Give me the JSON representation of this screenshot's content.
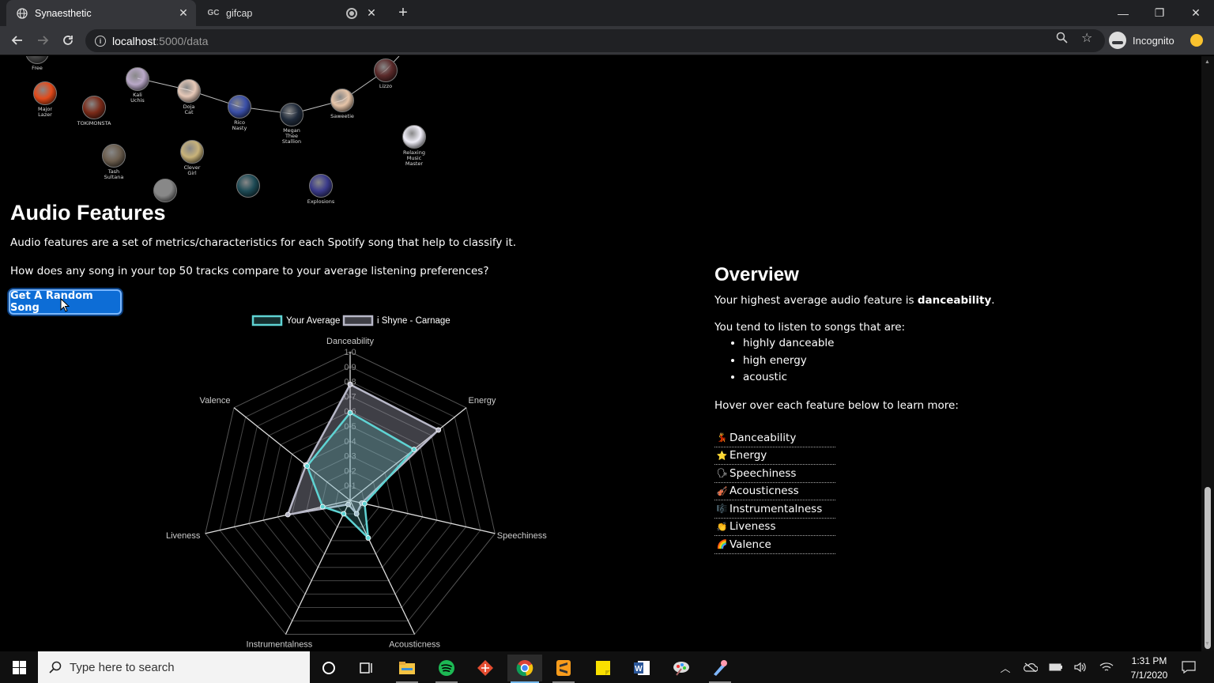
{
  "browser": {
    "tabs": [
      {
        "title": "Synaesthetic",
        "active": true
      },
      {
        "title": "gifcap",
        "active": false
      }
    ],
    "url_host": "localhost",
    "url_path": ":5000/data",
    "incognito_label": "Incognito"
  },
  "network": {
    "nodes": [
      {
        "label": "Major\nLazer",
        "color": "#e24a1a"
      },
      {
        "label": "TOKiMONSTA",
        "color": "#7a2a18"
      },
      {
        "label": "Kali\nUchis",
        "color": "#b9a8c8"
      },
      {
        "label": "Doja\nCat",
        "color": "#e7c9b8"
      },
      {
        "label": "Rico\nNasty",
        "color": "#3a4fa8"
      },
      {
        "label": "Megan\nThee\nStallion",
        "color": "#1f2a3a"
      },
      {
        "label": "Saweetie",
        "color": "#e6c4a8"
      },
      {
        "label": "Lizzo",
        "color": "#5a2a2a"
      },
      {
        "label": "Relaxing\nMusic\nMaster",
        "color": "#f0eef8"
      },
      {
        "label": "Tash\nSultana",
        "color": "#6b5d4d"
      },
      {
        "label": "Clever\nGirl",
        "color": "#c9b37a"
      },
      {
        "label": "",
        "color": "#888888"
      },
      {
        "label": "",
        "color": "#1d4a55"
      },
      {
        "label": "Explosions",
        "color": "#3a3a8a"
      },
      {
        "label": "Free",
        "color": "#444444"
      }
    ]
  },
  "audio_features": {
    "heading": "Audio Features",
    "description": "Audio features are a set of metrics/characteristics for each Spotify song that help to classify it.",
    "question": "How does any song in your top 50 tracks compare to your average listening preferences?",
    "button_label": "Get A Random Song"
  },
  "chart_data": {
    "type": "radar",
    "labels": [
      "Danceability",
      "Energy",
      "Speechiness",
      "Acousticness",
      "Instrumentalness",
      "Liveness",
      "Valence"
    ],
    "ticks": [
      "0.1",
      "0.2",
      "0.3",
      "0.4",
      "0.5",
      "0.6",
      "0.7",
      "0.8",
      "0.9",
      "1.0"
    ],
    "range": [
      0,
      1.0
    ],
    "series": [
      {
        "name": "Your Average",
        "color": "#5fd3d3",
        "values": [
          0.59,
          0.55,
          0.1,
          0.28,
          0.1,
          0.19,
          0.37
        ]
      },
      {
        "name": "i Shyne - Carnage",
        "color": "#b8b8c8",
        "values": [
          0.78,
          0.76,
          0.08,
          0.1,
          0.03,
          0.43,
          0.38
        ]
      }
    ]
  },
  "overview": {
    "heading": "Overview",
    "highest_prefix": "Your highest average audio feature is ",
    "highest_value": "danceability",
    "highest_suffix": ".",
    "tend_text": "You tend to listen to songs that are:",
    "traits": [
      "highly danceable",
      "high energy",
      "acoustic"
    ],
    "hover_text": "Hover over each feature below to learn more:",
    "features": [
      {
        "emoji": "💃",
        "label": "Danceability"
      },
      {
        "emoji": "⭐",
        "label": "Energy"
      },
      {
        "emoji": "🗣",
        "label": "Speechiness"
      },
      {
        "emoji": "🎻",
        "label": "Acousticness"
      },
      {
        "emoji": "🎼",
        "label": "Instrumentalness"
      },
      {
        "emoji": "👏",
        "label": "Liveness"
      },
      {
        "emoji": "🌈",
        "label": "Valence"
      }
    ]
  },
  "taskbar": {
    "search_placeholder": "Type here to search",
    "time": "1:31 PM",
    "date": "7/1/2020"
  }
}
